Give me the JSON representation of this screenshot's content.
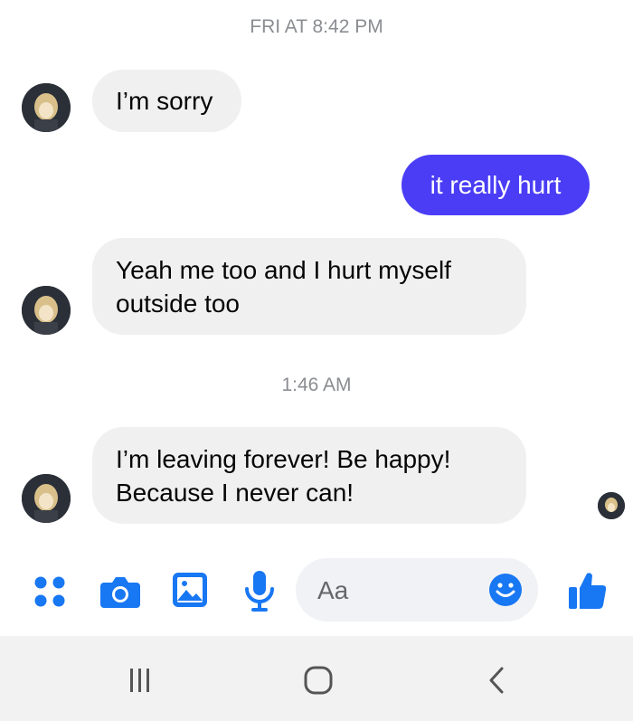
{
  "conversation": {
    "timestamp_1": "FRI AT 8:42 PM",
    "timestamp_2": "1:46 AM",
    "messages": [
      {
        "sender": "contact",
        "text_lines": [
          "I’m sorry"
        ]
      },
      {
        "sender": "me",
        "text_lines": [
          "it really hurt"
        ]
      },
      {
        "sender": "contact",
        "text_lines": [
          "Yeah me too and I hurt myself",
          "outside too"
        ]
      },
      {
        "sender": "contact",
        "text_lines": [
          "I’m leaving forever! Be happy!",
          "Because I never can!"
        ]
      }
    ]
  },
  "composer": {
    "placeholder": "Aa",
    "icons": [
      "menu-dots-icon",
      "camera-icon",
      "gallery-icon",
      "microphone-icon",
      "emoji-icon",
      "thumbs-up-icon"
    ]
  },
  "navbar": {
    "icons": [
      "recent-apps-icon",
      "home-icon",
      "back-icon"
    ]
  },
  "colors": {
    "accent": "#1877f2",
    "outgoing_bubble": "#4a3df5",
    "incoming_bubble": "#f0f0f0",
    "timestamp_text": "#8a8d91",
    "navbar_bg": "#f2f2f2"
  }
}
